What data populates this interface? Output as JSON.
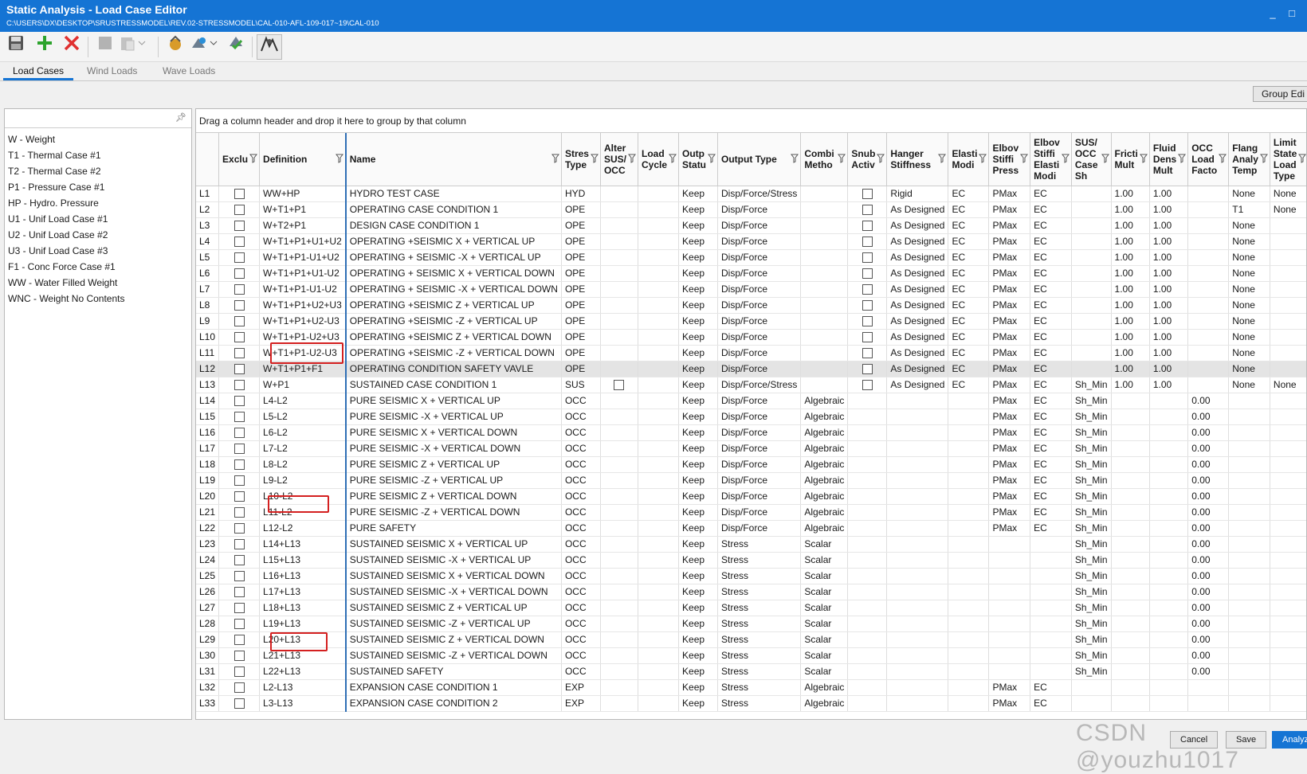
{
  "window": {
    "title": "Static Analysis - Load Case Editor",
    "path": "C:\\USERS\\DX\\DESKTOP\\SRUSTRESSMODEL\\REV.02-STRESSMODEL\\CAL-010-AFL-109-017~19\\CAL-010",
    "minimize": "_",
    "maximize": "□"
  },
  "toolbar": {
    "icons": [
      "save-icon",
      "add-icon",
      "delete-icon",
      "copy-icon",
      "paste-icon",
      "recommend-icon",
      "load-case-template-icon",
      "validate-icon",
      "analyze-icon"
    ]
  },
  "tabs": [
    "Load Cases",
    "Wind Loads",
    "Wave Loads"
  ],
  "group_edit_label": "Group Edi",
  "basic_loads": [
    "W - Weight",
    "T1 - Thermal Case #1",
    "T2 - Thermal Case #2",
    "P1 - Pressure Case #1",
    "HP - Hydro. Pressure",
    "U1 - Unif Load Case #1",
    "U2 - Unif Load Case #2",
    "U3 - Unif Load Case #3",
    "F1 - Conc Force Case #1",
    "WW - Water Filled Weight",
    "WNC - Weight No Contents"
  ],
  "group_hint": "Drag a column header and drop it here to group by that column",
  "columns": [
    [
      "",
      ""
    ],
    [
      "Exclu",
      ""
    ],
    [
      "Definition",
      ""
    ],
    [
      "Name",
      ""
    ],
    [
      "Stres",
      "Type"
    ],
    [
      "Alter",
      "SUS/",
      "OCC"
    ],
    [
      "Load",
      "Cycle"
    ],
    [
      "Outp",
      "Statu"
    ],
    [
      "Output Type",
      ""
    ],
    [
      "Combi",
      "Metho"
    ],
    [
      "Snub",
      "Activ"
    ],
    [
      "Hanger",
      "Stiffness"
    ],
    [
      "Elasti",
      "Modi"
    ],
    [
      "Elbov",
      "Stiffi",
      "Press"
    ],
    [
      "Elbov",
      "Stiffi",
      "Elasti",
      "Modi"
    ],
    [
      "SUS/",
      "OCC",
      "Case",
      "Sh"
    ],
    [
      "Fricti",
      "Mult"
    ],
    [
      "Fluid",
      "Dens",
      "Mult"
    ],
    [
      "OCC",
      "Load",
      "Facto"
    ],
    [
      "Flang",
      "Analy",
      "Temp"
    ],
    [
      "Limit",
      "State",
      "Load",
      "Type"
    ]
  ],
  "rows": [
    {
      "id": "L1",
      "def": "WW+HP",
      "name": "HYDRO TEST CASE",
      "st": "HYD",
      "alt": "",
      "cyc": "",
      "out": "Keep",
      "otype": "Disp/Force/Stress",
      "comb": "",
      "snub": true,
      "hang": "Rigid",
      "elas": "EC",
      "ep": "PMax",
      "ee": "EC",
      "sh": "",
      "fric": "1.00",
      "fluid": "1.00",
      "occ": "",
      "flang": "None",
      "limit": "None"
    },
    {
      "id": "L2",
      "def": "W+T1+P1",
      "name": "OPERATING CASE CONDITION 1",
      "st": "OPE",
      "alt": "",
      "cyc": "",
      "out": "Keep",
      "otype": "Disp/Force",
      "comb": "",
      "snub": true,
      "hang": "As Designed",
      "elas": "EC",
      "ep": "PMax",
      "ee": "EC",
      "sh": "",
      "fric": "1.00",
      "fluid": "1.00",
      "occ": "",
      "flang": "T1",
      "limit": "None"
    },
    {
      "id": "L3",
      "def": "W+T2+P1",
      "name": "DESIGN CASE CONDITION 1",
      "st": "OPE",
      "alt": "",
      "cyc": "",
      "out": "Keep",
      "otype": "Disp/Force",
      "comb": "",
      "snub": true,
      "hang": "As Designed",
      "elas": "EC",
      "ep": "PMax",
      "ee": "EC",
      "sh": "",
      "fric": "1.00",
      "fluid": "1.00",
      "occ": "",
      "flang": "None",
      "limit": ""
    },
    {
      "id": "L4",
      "def": "W+T1+P1+U1+U2",
      "name": "OPERATING +SEISMIC X + VERTICAL UP",
      "st": "OPE",
      "alt": "",
      "cyc": "",
      "out": "Keep",
      "otype": "Disp/Force",
      "comb": "",
      "snub": true,
      "hang": "As Designed",
      "elas": "EC",
      "ep": "PMax",
      "ee": "EC",
      "sh": "",
      "fric": "1.00",
      "fluid": "1.00",
      "occ": "",
      "flang": "None",
      "limit": ""
    },
    {
      "id": "L5",
      "def": "W+T1+P1-U1+U2",
      "name": "OPERATING + SEISMIC -X + VERTICAL UP",
      "st": "OPE",
      "alt": "",
      "cyc": "",
      "out": "Keep",
      "otype": "Disp/Force",
      "comb": "",
      "snub": true,
      "hang": "As Designed",
      "elas": "EC",
      "ep": "PMax",
      "ee": "EC",
      "sh": "",
      "fric": "1.00",
      "fluid": "1.00",
      "occ": "",
      "flang": "None",
      "limit": ""
    },
    {
      "id": "L6",
      "def": "W+T1+P1+U1-U2",
      "name": "OPERATING + SEISMIC X + VERTICAL DOWN",
      "st": "OPE",
      "alt": "",
      "cyc": "",
      "out": "Keep",
      "otype": "Disp/Force",
      "comb": "",
      "snub": true,
      "hang": "As Designed",
      "elas": "EC",
      "ep": "PMax",
      "ee": "EC",
      "sh": "",
      "fric": "1.00",
      "fluid": "1.00",
      "occ": "",
      "flang": "None",
      "limit": ""
    },
    {
      "id": "L7",
      "def": "W+T1+P1-U1-U2",
      "name": "OPERATING + SEISMIC -X + VERTICAL DOWN",
      "st": "OPE",
      "alt": "",
      "cyc": "",
      "out": "Keep",
      "otype": "Disp/Force",
      "comb": "",
      "snub": true,
      "hang": "As Designed",
      "elas": "EC",
      "ep": "PMax",
      "ee": "EC",
      "sh": "",
      "fric": "1.00",
      "fluid": "1.00",
      "occ": "",
      "flang": "None",
      "limit": ""
    },
    {
      "id": "L8",
      "def": "W+T1+P1+U2+U3",
      "name": "OPERATING +SEISMIC Z + VERTICAL UP",
      "st": "OPE",
      "alt": "",
      "cyc": "",
      "out": "Keep",
      "otype": "Disp/Force",
      "comb": "",
      "snub": true,
      "hang": "As Designed",
      "elas": "EC",
      "ep": "PMax",
      "ee": "EC",
      "sh": "",
      "fric": "1.00",
      "fluid": "1.00",
      "occ": "",
      "flang": "None",
      "limit": ""
    },
    {
      "id": "L9",
      "def": "W+T1+P1+U2-U3",
      "name": "OPERATING +SEISMIC -Z + VERTICAL UP",
      "st": "OPE",
      "alt": "",
      "cyc": "",
      "out": "Keep",
      "otype": "Disp/Force",
      "comb": "",
      "snub": true,
      "hang": "As Designed",
      "elas": "EC",
      "ep": "PMax",
      "ee": "EC",
      "sh": "",
      "fric": "1.00",
      "fluid": "1.00",
      "occ": "",
      "flang": "None",
      "limit": ""
    },
    {
      "id": "L10",
      "def": "W+T1+P1-U2+U3",
      "name": "OPERATING +SEISMIC Z + VERTICAL DOWN",
      "st": "OPE",
      "alt": "",
      "cyc": "",
      "out": "Keep",
      "otype": "Disp/Force",
      "comb": "",
      "snub": true,
      "hang": "As Designed",
      "elas": "EC",
      "ep": "PMax",
      "ee": "EC",
      "sh": "",
      "fric": "1.00",
      "fluid": "1.00",
      "occ": "",
      "flang": "None",
      "limit": ""
    },
    {
      "id": "L11",
      "def": "W+T1+P1-U2-U3",
      "name": "OPERATING +SEISMIC -Z + VERTICAL DOWN",
      "st": "OPE",
      "alt": "",
      "cyc": "",
      "out": "Keep",
      "otype": "Disp/Force",
      "comb": "",
      "snub": true,
      "hang": "As Designed",
      "elas": "EC",
      "ep": "PMax",
      "ee": "EC",
      "sh": "",
      "fric": "1.00",
      "fluid": "1.00",
      "occ": "",
      "flang": "None",
      "limit": ""
    },
    {
      "id": "L12",
      "def": "W+T1+P1+F1",
      "name": "OPERATING CONDITION SAFETY VAVLE",
      "st": "OPE",
      "alt": "",
      "cyc": "",
      "out": "Keep",
      "otype": "Disp/Force",
      "comb": "",
      "snub": true,
      "hang": "As Designed",
      "elas": "EC",
      "ep": "PMax",
      "ee": "EC",
      "sh": "",
      "fric": "1.00",
      "fluid": "1.00",
      "occ": "",
      "flang": "None",
      "limit": "",
      "selected": true
    },
    {
      "id": "L13",
      "def": "W+P1",
      "name": "SUSTAINED CASE CONDITION 1",
      "st": "SUS",
      "altcb": true,
      "cyc": "",
      "out": "Keep",
      "otype": "Disp/Force/Stress",
      "comb": "",
      "snub": true,
      "hang": "As Designed",
      "elas": "EC",
      "ep": "PMax",
      "ee": "EC",
      "sh": "Sh_Min",
      "fric": "1.00",
      "fluid": "1.00",
      "occ": "",
      "flang": "None",
      "limit": "None"
    },
    {
      "id": "L14",
      "def": "L4-L2",
      "name": "PURE SEISMIC X + VERTICAL UP",
      "st": "OCC",
      "cyc": "",
      "out": "Keep",
      "otype": "Disp/Force",
      "comb": "Algebraic",
      "hang": "",
      "elas": "",
      "ep": "PMax",
      "ee": "EC",
      "sh": "Sh_Min",
      "fric": "",
      "fluid": "",
      "occ": "0.00",
      "flang": "",
      "limit": ""
    },
    {
      "id": "L15",
      "def": "L5-L2",
      "name": "PURE SEISMIC -X + VERTICAL UP",
      "st": "OCC",
      "cyc": "",
      "out": "Keep",
      "otype": "Disp/Force",
      "comb": "Algebraic",
      "hang": "",
      "elas": "",
      "ep": "PMax",
      "ee": "EC",
      "sh": "Sh_Min",
      "fric": "",
      "fluid": "",
      "occ": "0.00",
      "flang": "",
      "limit": ""
    },
    {
      "id": "L16",
      "def": "L6-L2",
      "name": "PURE SEISMIC X + VERTICAL DOWN",
      "st": "OCC",
      "cyc": "",
      "out": "Keep",
      "otype": "Disp/Force",
      "comb": "Algebraic",
      "hang": "",
      "elas": "",
      "ep": "PMax",
      "ee": "EC",
      "sh": "Sh_Min",
      "fric": "",
      "fluid": "",
      "occ": "0.00",
      "flang": "",
      "limit": ""
    },
    {
      "id": "L17",
      "def": "L7-L2",
      "name": "PURE SEISMIC -X + VERTICAL DOWN",
      "st": "OCC",
      "cyc": "",
      "out": "Keep",
      "otype": "Disp/Force",
      "comb": "Algebraic",
      "hang": "",
      "elas": "",
      "ep": "PMax",
      "ee": "EC",
      "sh": "Sh_Min",
      "fric": "",
      "fluid": "",
      "occ": "0.00",
      "flang": "",
      "limit": ""
    },
    {
      "id": "L18",
      "def": "L8-L2",
      "name": "PURE SEISMIC Z + VERTICAL UP",
      "st": "OCC",
      "cyc": "",
      "out": "Keep",
      "otype": "Disp/Force",
      "comb": "Algebraic",
      "hang": "",
      "elas": "",
      "ep": "PMax",
      "ee": "EC",
      "sh": "Sh_Min",
      "fric": "",
      "fluid": "",
      "occ": "0.00",
      "flang": "",
      "limit": ""
    },
    {
      "id": "L19",
      "def": "L9-L2",
      "name": "PURE SEISMIC -Z + VERTICAL UP",
      "st": "OCC",
      "cyc": "",
      "out": "Keep",
      "otype": "Disp/Force",
      "comb": "Algebraic",
      "hang": "",
      "elas": "",
      "ep": "PMax",
      "ee": "EC",
      "sh": "Sh_Min",
      "fric": "",
      "fluid": "",
      "occ": "0.00",
      "flang": "",
      "limit": ""
    },
    {
      "id": "L20",
      "def": "L10-L2",
      "name": "PURE SEISMIC Z + VERTICAL DOWN",
      "st": "OCC",
      "cyc": "",
      "out": "Keep",
      "otype": "Disp/Force",
      "comb": "Algebraic",
      "hang": "",
      "elas": "",
      "ep": "PMax",
      "ee": "EC",
      "sh": "Sh_Min",
      "fric": "",
      "fluid": "",
      "occ": "0.00",
      "flang": "",
      "limit": ""
    },
    {
      "id": "L21",
      "def": "L11-L2",
      "name": "PURE SEISMIC -Z + VERTICAL DOWN",
      "st": "OCC",
      "cyc": "",
      "out": "Keep",
      "otype": "Disp/Force",
      "comb": "Algebraic",
      "hang": "",
      "elas": "",
      "ep": "PMax",
      "ee": "EC",
      "sh": "Sh_Min",
      "fric": "",
      "fluid": "",
      "occ": "0.00",
      "flang": "",
      "limit": ""
    },
    {
      "id": "L22",
      "def": "L12-L2",
      "name": "PURE SAFETY",
      "st": "OCC",
      "cyc": "",
      "out": "Keep",
      "otype": "Disp/Force",
      "comb": "Algebraic",
      "hang": "",
      "elas": "",
      "ep": "PMax",
      "ee": "EC",
      "sh": "Sh_Min",
      "fric": "",
      "fluid": "",
      "occ": "0.00",
      "flang": "",
      "limit": ""
    },
    {
      "id": "L23",
      "def": "L14+L13",
      "name": "SUSTAINED SEISMIC X + VERTICAL UP",
      "st": "OCC",
      "cyc": "",
      "out": "Keep",
      "otype": "Stress",
      "comb": "Scalar",
      "hang": "",
      "elas": "",
      "ep": "",
      "ee": "",
      "sh": "Sh_Min",
      "fric": "",
      "fluid": "",
      "occ": "0.00",
      "flang": "",
      "limit": ""
    },
    {
      "id": "L24",
      "def": "L15+L13",
      "name": "SUSTAINED SEISMIC -X + VERTICAL UP",
      "st": "OCC",
      "cyc": "",
      "out": "Keep",
      "otype": "Stress",
      "comb": "Scalar",
      "hang": "",
      "elas": "",
      "ep": "",
      "ee": "",
      "sh": "Sh_Min",
      "fric": "",
      "fluid": "",
      "occ": "0.00",
      "flang": "",
      "limit": ""
    },
    {
      "id": "L25",
      "def": "L16+L13",
      "name": "SUSTAINED SEISMIC X + VERTICAL DOWN",
      "st": "OCC",
      "cyc": "",
      "out": "Keep",
      "otype": "Stress",
      "comb": "Scalar",
      "hang": "",
      "elas": "",
      "ep": "",
      "ee": "",
      "sh": "Sh_Min",
      "fric": "",
      "fluid": "",
      "occ": "0.00",
      "flang": "",
      "limit": ""
    },
    {
      "id": "L26",
      "def": "L17+L13",
      "name": "SUSTAINED SEISMIC -X + VERTICAL DOWN",
      "st": "OCC",
      "cyc": "",
      "out": "Keep",
      "otype": "Stress",
      "comb": "Scalar",
      "hang": "",
      "elas": "",
      "ep": "",
      "ee": "",
      "sh": "Sh_Min",
      "fric": "",
      "fluid": "",
      "occ": "0.00",
      "flang": "",
      "limit": ""
    },
    {
      "id": "L27",
      "def": "L18+L13",
      "name": "SUSTAINED SEISMIC Z + VERTICAL UP",
      "st": "OCC",
      "cyc": "",
      "out": "Keep",
      "otype": "Stress",
      "comb": "Scalar",
      "hang": "",
      "elas": "",
      "ep": "",
      "ee": "",
      "sh": "Sh_Min",
      "fric": "",
      "fluid": "",
      "occ": "0.00",
      "flang": "",
      "limit": ""
    },
    {
      "id": "L28",
      "def": "L19+L13",
      "name": "SUSTAINED SEISMIC -Z + VERTICAL UP",
      "st": "OCC",
      "cyc": "",
      "out": "Keep",
      "otype": "Stress",
      "comb": "Scalar",
      "hang": "",
      "elas": "",
      "ep": "",
      "ee": "",
      "sh": "Sh_Min",
      "fric": "",
      "fluid": "",
      "occ": "0.00",
      "flang": "",
      "limit": ""
    },
    {
      "id": "L29",
      "def": "L20+L13",
      "name": "SUSTAINED SEISMIC Z + VERTICAL DOWN",
      "st": "OCC",
      "cyc": "",
      "out": "Keep",
      "otype": "Stress",
      "comb": "Scalar",
      "hang": "",
      "elas": "",
      "ep": "",
      "ee": "",
      "sh": "Sh_Min",
      "fric": "",
      "fluid": "",
      "occ": "0.00",
      "flang": "",
      "limit": ""
    },
    {
      "id": "L30",
      "def": "L21+L13",
      "name": "SUSTAINED SEISMIC -Z + VERTICAL DOWN",
      "st": "OCC",
      "cyc": "",
      "out": "Keep",
      "otype": "Stress",
      "comb": "Scalar",
      "hang": "",
      "elas": "",
      "ep": "",
      "ee": "",
      "sh": "Sh_Min",
      "fric": "",
      "fluid": "",
      "occ": "0.00",
      "flang": "",
      "limit": ""
    },
    {
      "id": "L31",
      "def": "L22+L13",
      "name": "SUSTAINED SAFETY",
      "st": "OCC",
      "cyc": "",
      "out": "Keep",
      "otype": "Stress",
      "comb": "Scalar",
      "hang": "",
      "elas": "",
      "ep": "",
      "ee": "",
      "sh": "Sh_Min",
      "fric": "",
      "fluid": "",
      "occ": "0.00",
      "flang": "",
      "limit": ""
    },
    {
      "id": "L32",
      "def": "L2-L13",
      "name": "EXPANSION CASE CONDITION 1",
      "st": "EXP",
      "cyc": "",
      "out": "Keep",
      "otype": "Stress",
      "comb": "Algebraic",
      "hang": "",
      "elas": "",
      "ep": "PMax",
      "ee": "EC",
      "sh": "",
      "fric": "",
      "fluid": "",
      "occ": "",
      "flang": "",
      "limit": ""
    },
    {
      "id": "L33",
      "def": "L3-L13",
      "name": "EXPANSION CASE CONDITION 2",
      "st": "EXP",
      "cyc": "",
      "out": "Keep",
      "otype": "Stress",
      "comb": "Algebraic",
      "hang": "",
      "elas": "",
      "ep": "PMax",
      "ee": "EC",
      "sh": "",
      "fric": "",
      "fluid": "",
      "occ": "",
      "flang": "",
      "limit": ""
    }
  ],
  "highlighted_cells": [
    "L12",
    "L22",
    "L31"
  ],
  "buttons": {
    "cancel": "Cancel",
    "save": "Save",
    "analyze": "Analyze"
  },
  "watermark": "CSDN @youzhu1017",
  "colors": {
    "titlebar": "#1574d4",
    "highlight": "#d42020",
    "selected_row": "#e4e4e4"
  }
}
